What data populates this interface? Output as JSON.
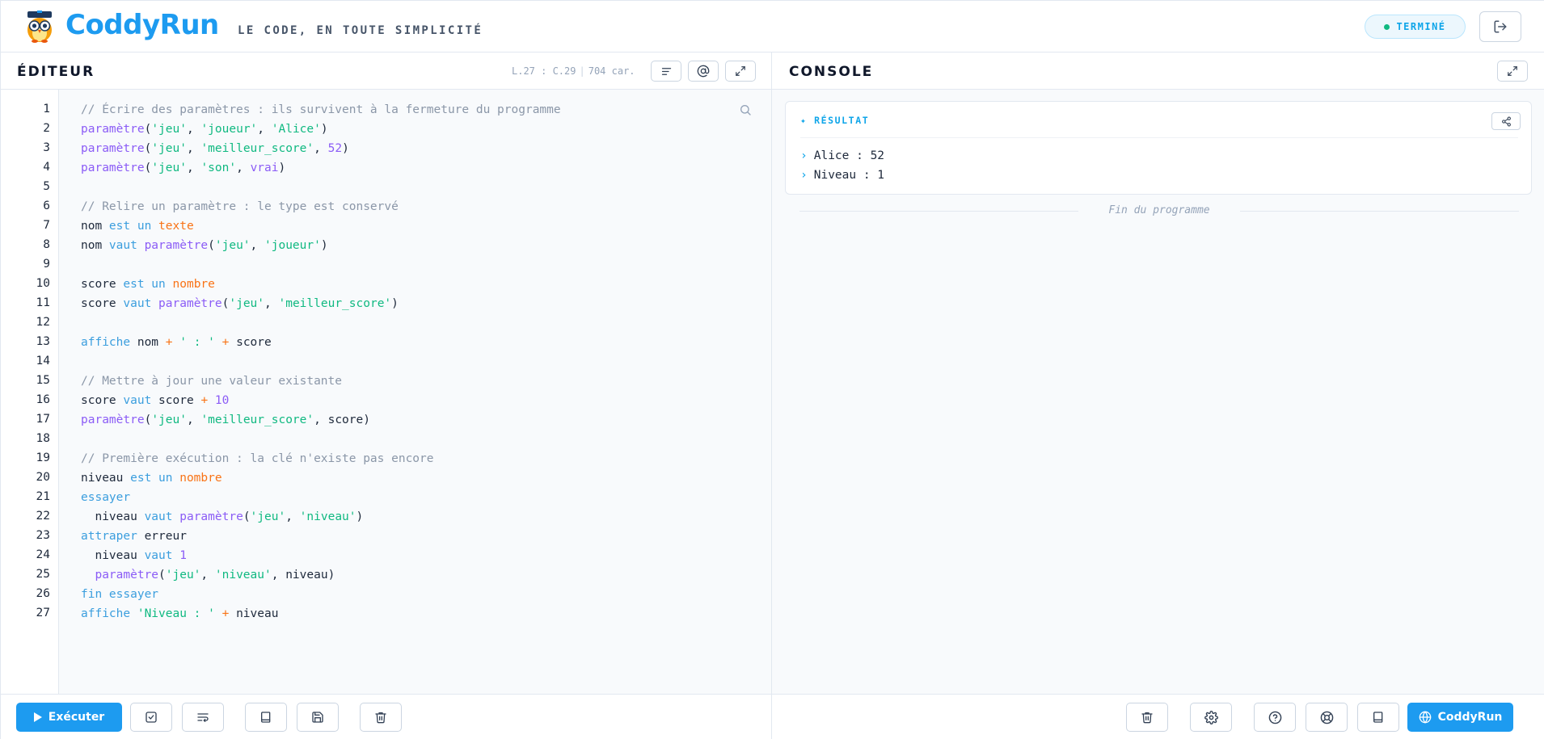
{
  "header": {
    "brand": "CoddyRun",
    "tagline": "LE CODE, EN TOUTE SIMPLICITÉ",
    "status": "TERMINÉ",
    "status_color": "#10b981"
  },
  "editor": {
    "title": "ÉDITEUR",
    "cursor": "L.27 : C.29",
    "chars": "704 car.",
    "lines": [
      [
        [
          "// Écrire des paramètres : ils survivent à la fermeture du programme",
          "com"
        ]
      ],
      [
        [
          "paramètre",
          "fn"
        ],
        [
          "(",
          "id"
        ],
        [
          "'jeu'",
          "str"
        ],
        [
          ", ",
          "id"
        ],
        [
          "'joueur'",
          "str"
        ],
        [
          ", ",
          "id"
        ],
        [
          "'Alice'",
          "str"
        ],
        [
          ")",
          "id"
        ]
      ],
      [
        [
          "paramètre",
          "fn"
        ],
        [
          "(",
          "id"
        ],
        [
          "'jeu'",
          "str"
        ],
        [
          ", ",
          "id"
        ],
        [
          "'meilleur_score'",
          "str"
        ],
        [
          ", ",
          "id"
        ],
        [
          "52",
          "num"
        ],
        [
          ")",
          "id"
        ]
      ],
      [
        [
          "paramètre",
          "fn"
        ],
        [
          "(",
          "id"
        ],
        [
          "'jeu'",
          "str"
        ],
        [
          ", ",
          "id"
        ],
        [
          "'son'",
          "str"
        ],
        [
          ", ",
          "id"
        ],
        [
          "vrai",
          "num"
        ],
        [
          ")",
          "id"
        ]
      ],
      [],
      [
        [
          "// Relire un paramètre : le type est conservé",
          "com"
        ]
      ],
      [
        [
          "nom ",
          "id"
        ],
        [
          "est un ",
          "kw"
        ],
        [
          "texte",
          "type"
        ]
      ],
      [
        [
          "nom ",
          "id"
        ],
        [
          "vaut ",
          "kw"
        ],
        [
          "paramètre",
          "fn"
        ],
        [
          "(",
          "id"
        ],
        [
          "'jeu'",
          "str"
        ],
        [
          ", ",
          "id"
        ],
        [
          "'joueur'",
          "str"
        ],
        [
          ")",
          "id"
        ]
      ],
      [],
      [
        [
          "score ",
          "id"
        ],
        [
          "est un ",
          "kw"
        ],
        [
          "nombre",
          "type"
        ]
      ],
      [
        [
          "score ",
          "id"
        ],
        [
          "vaut ",
          "kw"
        ],
        [
          "paramètre",
          "fn"
        ],
        [
          "(",
          "id"
        ],
        [
          "'jeu'",
          "str"
        ],
        [
          ", ",
          "id"
        ],
        [
          "'meilleur_score'",
          "str"
        ],
        [
          ")",
          "id"
        ]
      ],
      [],
      [
        [
          "affiche ",
          "kw"
        ],
        [
          "nom ",
          "id"
        ],
        [
          "+ ",
          "op"
        ],
        [
          "' : ' ",
          "str"
        ],
        [
          "+ ",
          "op"
        ],
        [
          "score",
          "id"
        ]
      ],
      [],
      [
        [
          "// Mettre à jour une valeur existante",
          "com"
        ]
      ],
      [
        [
          "score ",
          "id"
        ],
        [
          "vaut ",
          "kw"
        ],
        [
          "score ",
          "id"
        ],
        [
          "+ ",
          "op"
        ],
        [
          "10",
          "num"
        ]
      ],
      [
        [
          "paramètre",
          "fn"
        ],
        [
          "(",
          "id"
        ],
        [
          "'jeu'",
          "str"
        ],
        [
          ", ",
          "id"
        ],
        [
          "'meilleur_score'",
          "str"
        ],
        [
          ", score)",
          "id"
        ]
      ],
      [],
      [
        [
          "// Première exécution : la clé n'existe pas encore",
          "com"
        ]
      ],
      [
        [
          "niveau ",
          "id"
        ],
        [
          "est un ",
          "kw"
        ],
        [
          "nombre",
          "type"
        ]
      ],
      [
        [
          "essayer",
          "kw"
        ]
      ],
      [
        [
          "  niveau ",
          "id"
        ],
        [
          "vaut ",
          "kw"
        ],
        [
          "paramètre",
          "fn"
        ],
        [
          "(",
          "id"
        ],
        [
          "'jeu'",
          "str"
        ],
        [
          ", ",
          "id"
        ],
        [
          "'niveau'",
          "str"
        ],
        [
          ")",
          "id"
        ]
      ],
      [
        [
          "attraper ",
          "kw"
        ],
        [
          "erreur",
          "id"
        ]
      ],
      [
        [
          "  niveau ",
          "id"
        ],
        [
          "vaut ",
          "kw"
        ],
        [
          "1",
          "num"
        ]
      ],
      [
        [
          "  paramètre",
          "fn"
        ],
        [
          "(",
          "id"
        ],
        [
          "'jeu'",
          "str"
        ],
        [
          ", ",
          "id"
        ],
        [
          "'niveau'",
          "str"
        ],
        [
          ", niveau)",
          "id"
        ]
      ],
      [
        [
          "fin essayer",
          "kw"
        ]
      ],
      [
        [
          "affiche ",
          "kw"
        ],
        [
          "'Niveau : ' ",
          "str"
        ],
        [
          "+ ",
          "op"
        ],
        [
          "niveau",
          "id"
        ]
      ]
    ],
    "run_label": "Exécuter"
  },
  "console": {
    "title": "CONSOLE",
    "result_label": "RÉSULTAT",
    "output": [
      "Alice : 52",
      "Niveau : 1"
    ],
    "end_text": "Fin du programme",
    "site_label": "CoddyRun"
  },
  "colors": {
    "accent": "#1d9bf0",
    "comment": "#8b97a8",
    "function": "#8b5cf6",
    "string": "#10b981",
    "keyword": "#3b9ede",
    "type": "#f97316"
  }
}
